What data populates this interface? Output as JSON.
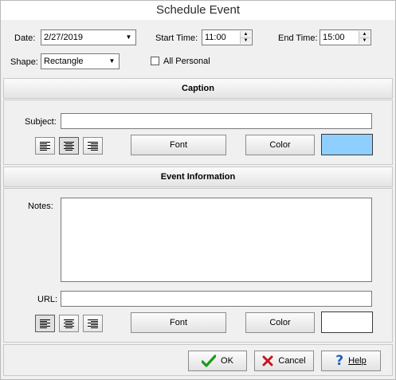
{
  "window": {
    "title": "Schedule Event"
  },
  "top": {
    "date_label": "Date:",
    "date_value": "2/27/2019",
    "start_time_label": "Start Time:",
    "start_time_value": "11:00",
    "end_time_label": "End Time:",
    "end_time_value": "15:00",
    "shape_label": "Shape:",
    "shape_value": "Rectangle",
    "all_personal_label": "All Personal",
    "all_personal_checked": false
  },
  "caption": {
    "header": "Caption",
    "subject_label": "Subject:",
    "subject_value": "",
    "font_button": "Font",
    "color_button": "Color",
    "color_swatch": "#8fcfff",
    "selected_alignment": "center"
  },
  "event_info": {
    "header": "Event Information",
    "notes_label": "Notes:",
    "notes_value": "",
    "url_label": "URL:",
    "url_value": "",
    "font_button": "Font",
    "color_button": "Color",
    "color_swatch": "#ffffff",
    "selected_alignment": "left"
  },
  "footer": {
    "ok_label": "OK",
    "cancel_label": "Cancel",
    "help_label": "Help"
  },
  "icons": {
    "ok": "check-icon",
    "cancel": "x-icon",
    "help": "question-icon",
    "align_left": "align-left-icon",
    "align_center": "align-center-icon",
    "align_right": "align-right-icon"
  }
}
